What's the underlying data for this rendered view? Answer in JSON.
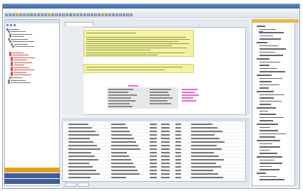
{
  "window": {
    "title": ""
  },
  "menu": {
    "items": [
      "",
      "",
      "",
      "",
      "",
      "",
      "",
      "",
      "",
      ""
    ]
  },
  "left_panel": {
    "header": "",
    "tree_items": [
      {
        "label": "",
        "color": "blue"
      },
      {
        "label": "",
        "color": "black"
      },
      {
        "label": "",
        "color": "black"
      },
      {
        "label": "",
        "color": "black"
      },
      {
        "label": "",
        "color": "black"
      },
      {
        "label": "",
        "color": "black"
      },
      {
        "label": "",
        "color": "black"
      },
      {
        "label": "",
        "color": "black"
      },
      {
        "label": "",
        "color": "red"
      },
      {
        "label": "",
        "color": "red"
      },
      {
        "label": "",
        "color": "red"
      },
      {
        "label": "",
        "color": "red"
      },
      {
        "label": "",
        "color": "red"
      },
      {
        "label": "",
        "color": "red"
      },
      {
        "label": "",
        "color": "red"
      },
      {
        "label": "",
        "color": "red"
      },
      {
        "label": "",
        "color": "red"
      },
      {
        "label": "",
        "color": "red"
      },
      {
        "label": "",
        "color": "black"
      },
      {
        "label": "",
        "color": "black"
      },
      {
        "label": "",
        "color": "black"
      }
    ],
    "bottom_items": [
      {
        "label": "",
        "color": "#e0a020"
      },
      {
        "label": "",
        "color": "#3d5f9a"
      },
      {
        "label": "",
        "color": "#3d5f9a"
      }
    ]
  },
  "document": {
    "tab_label": ""
  },
  "grid": {
    "header": "",
    "row_count": 16
  },
  "bottom_tabs": [
    "",
    ""
  ],
  "right_panel": {
    "header": "",
    "item_count": 48
  },
  "colors": {
    "titlebar": "#3e6aa8",
    "note_fill": "#f5f2a8",
    "highlight": "#e86ad8",
    "accent": "#e8b84b"
  }
}
